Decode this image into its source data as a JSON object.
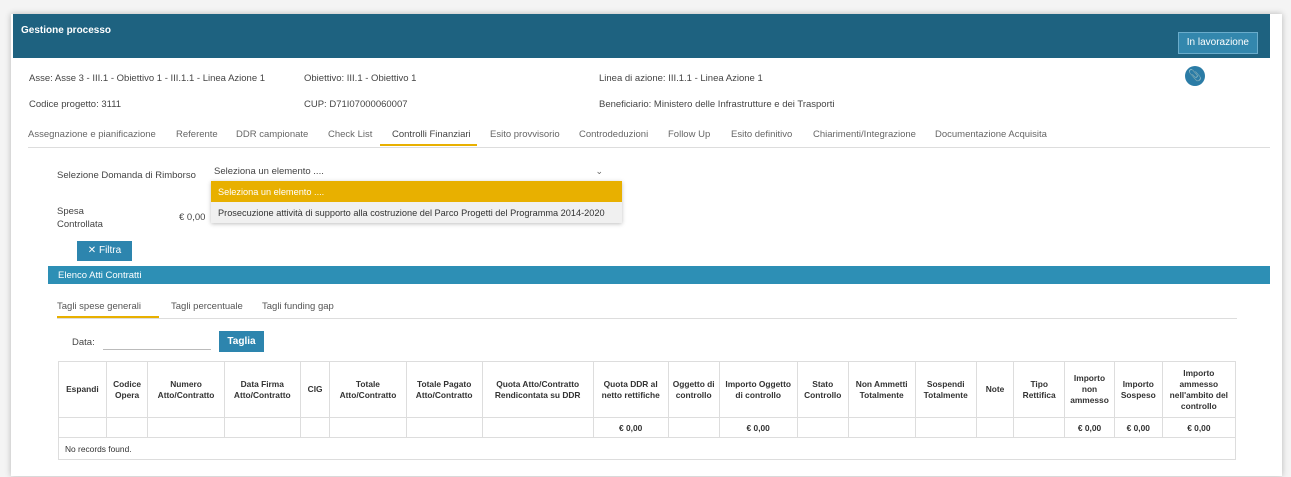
{
  "header": {
    "title": "Gestione processo",
    "status_label": "In lavorazione"
  },
  "info": {
    "asse": "Asse: Asse 3 - III.1 - Obiettivo 1 - III.1.1 - Linea Azione 1",
    "obiettivo": "Obiettivo: III.1 - Obiettivo 1",
    "linea": "Linea di azione: III.1.1 - Linea Azione 1",
    "codice": "Codice progetto: 3111",
    "cup": "CUP: D71I07000060007",
    "beneficiario": "Beneficiario: Ministero delle Infrastrutture e dei Trasporti",
    "attach_icon": "paperclip-icon"
  },
  "tabs": [
    "Assegnazione e pianificazione",
    "Referente",
    "DDR campionate",
    "Check List",
    "Controlli Finanziari",
    "Esito provvisorio",
    "Controdeduzioni",
    "Follow Up",
    "Esito definitivo",
    "Chiarimenti/Integrazione",
    "Documentazione Acquisita"
  ],
  "active_tab": "Controlli Finanziari",
  "form": {
    "selezione_label": "Selezione Domanda di Rimborso",
    "select_value": "Seleziona un elemento ....",
    "dropdown": [
      "Seleziona un elemento ....",
      "Prosecuzione attività di supporto alla costruzione del Parco Progetti del Programma 2014-2020"
    ],
    "spesa_label_1": "Spesa",
    "spesa_label_2": "Controllata",
    "spesa_value": "€ 0,00",
    "filtra_label": "Filtra"
  },
  "band_title": "Elenco Atti Contratti",
  "subtabs": [
    "Tagli spese generali",
    "Tagli percentuale",
    "Tagli funding gap"
  ],
  "data_label": "Data:",
  "taglia_label": "Taglia",
  "table": {
    "columns": [
      "Espandi",
      "Codice Opera",
      "Numero Atto/Contratto",
      "Data Firma Atto/Contratto",
      "CIG",
      "Totale Atto/Contratto",
      "Totale Pagato Atto/Contratto",
      "Quota Atto/Contratto Rendicontata su DDR",
      "Quota DDR al netto rettifiche",
      "Oggetto di controllo",
      "Importo Oggetto di controllo",
      "Stato Controllo",
      "Non Ammetti Totalmente",
      "Sospendi Totalmente",
      "Note",
      "Tipo Rettifica",
      "Importo non ammesso",
      "Importo Sospeso",
      "Importo ammesso nell'ambito del controllo"
    ],
    "totals": [
      "",
      "",
      "",
      "",
      "",
      "",
      "",
      "",
      "€ 0,00",
      "",
      "€ 0,00",
      "",
      "",
      "",
      "",
      "",
      "€ 0,00",
      "€ 0,00",
      "€ 0,00"
    ],
    "empty_message": "No records found."
  }
}
